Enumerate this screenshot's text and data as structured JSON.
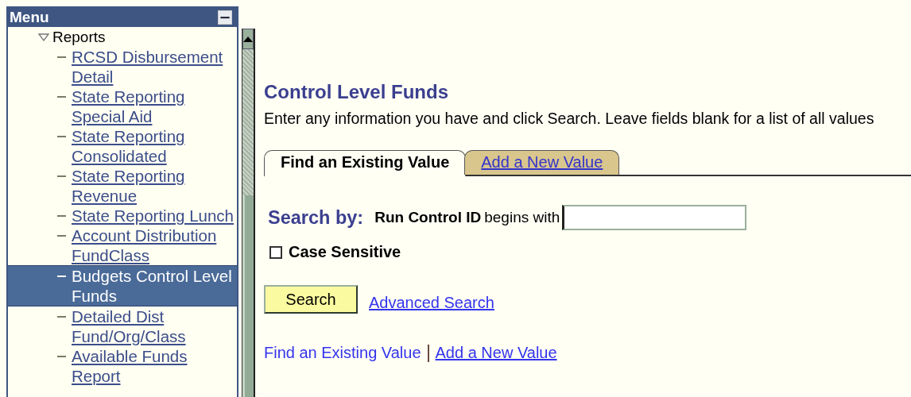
{
  "menu": {
    "title": "Menu",
    "collapse_button": "−",
    "items": [
      {
        "label": "Reports",
        "expanded": true,
        "children": [
          {
            "label": "RCSD Disbursement Detail",
            "selected": false
          },
          {
            "label": "State Reporting Special Aid",
            "selected": false
          },
          {
            "label": "State Reporting Consolidated",
            "selected": false
          },
          {
            "label": "State Reporting Revenue",
            "selected": false
          },
          {
            "label": "State Reporting Lunch",
            "selected": false
          },
          {
            "label": "Account Distribution FundClass",
            "selected": false
          },
          {
            "label": "Budgets Control Level Funds",
            "selected": true
          },
          {
            "label": "Detailed Dist Fund/Org/Class",
            "selected": false
          },
          {
            "label": "Available Funds Report",
            "selected": false
          }
        ]
      }
    ]
  },
  "page": {
    "title": "Control Level Funds",
    "instructions": "Enter any information you have and click Search. Leave fields blank for a list of all values",
    "tabs": [
      {
        "label": "Find an Existing Value",
        "selected": true
      },
      {
        "label": "Add a New Value",
        "selected": false
      }
    ],
    "search_by_label": "Search by:",
    "field_label": "Run Control ID",
    "operator": "begins with",
    "case_sensitive": {
      "label": "Case Sensitive",
      "checked": false
    },
    "search_button": "Search",
    "advanced_search_link": "Advanced Search",
    "footer_links": [
      "Find an Existing Value",
      "Add a New Value"
    ]
  }
}
